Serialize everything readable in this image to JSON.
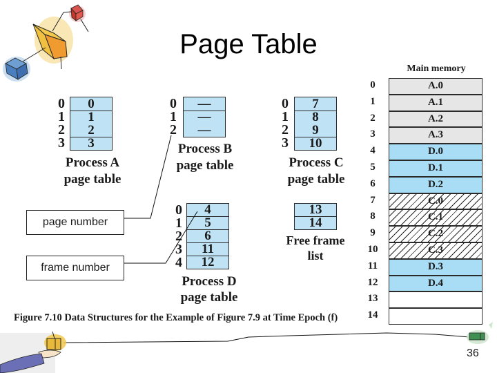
{
  "slide": {
    "title": "Page Table",
    "page_number": "36",
    "figure_caption": "Figure 7.10  Data Structures for the Example of Figure 7.9 at Time Epoch (f)"
  },
  "legend_boxes": {
    "page_number": "page number",
    "frame_number": "frame number"
  },
  "page_tables": {
    "process_a": {
      "label_line1": "Process A",
      "label_line2": "page table",
      "indices": [
        "0",
        "1",
        "2",
        "3"
      ],
      "frames": [
        "0",
        "1",
        "2",
        "3"
      ]
    },
    "process_b": {
      "label_line1": "Process B",
      "label_line2": "page table",
      "indices": [
        "0",
        "1",
        "2"
      ],
      "frames": [
        "—",
        "—",
        "—"
      ]
    },
    "process_c": {
      "label_line1": "Process C",
      "label_line2": "page table",
      "indices": [
        "0",
        "1",
        "2",
        "3"
      ],
      "frames": [
        "7",
        "8",
        "9",
        "10"
      ]
    },
    "process_d": {
      "label_line1": "Process D",
      "label_line2": "page table",
      "indices": [
        "0",
        "1",
        "2",
        "3",
        "4"
      ],
      "frames": [
        "4",
        "5",
        "6",
        "11",
        "12"
      ]
    },
    "free_frame_list": {
      "label_line1": "Free frame",
      "label_line2": "list",
      "frames": [
        "13",
        "14"
      ]
    }
  },
  "main_memory": {
    "title": "Main memory",
    "frames": [
      {
        "index": "0",
        "content": "A.0",
        "owner": "A"
      },
      {
        "index": "1",
        "content": "A.1",
        "owner": "A"
      },
      {
        "index": "2",
        "content": "A.2",
        "owner": "A"
      },
      {
        "index": "3",
        "content": "A.3",
        "owner": "A"
      },
      {
        "index": "4",
        "content": "D.0",
        "owner": "D"
      },
      {
        "index": "5",
        "content": "D.1",
        "owner": "D"
      },
      {
        "index": "6",
        "content": "D.2",
        "owner": "D"
      },
      {
        "index": "7",
        "content": "C.0",
        "owner": "C"
      },
      {
        "index": "8",
        "content": "C.1",
        "owner": "C"
      },
      {
        "index": "9",
        "content": "C.2",
        "owner": "C"
      },
      {
        "index": "10",
        "content": "C.3",
        "owner": "C"
      },
      {
        "index": "11",
        "content": "D.3",
        "owner": "D"
      },
      {
        "index": "12",
        "content": "D.4",
        "owner": "D"
      },
      {
        "index": "13",
        "content": "",
        "owner": "free"
      },
      {
        "index": "14",
        "content": "",
        "owner": "free"
      }
    ]
  },
  "colors": {
    "page_table_fill": "#bfe3f5",
    "process_a_frame": "#e6e6e6",
    "process_d_frame": "#a9dcf5",
    "free_frame": "#ffffff",
    "border": "#2a2a2a"
  }
}
